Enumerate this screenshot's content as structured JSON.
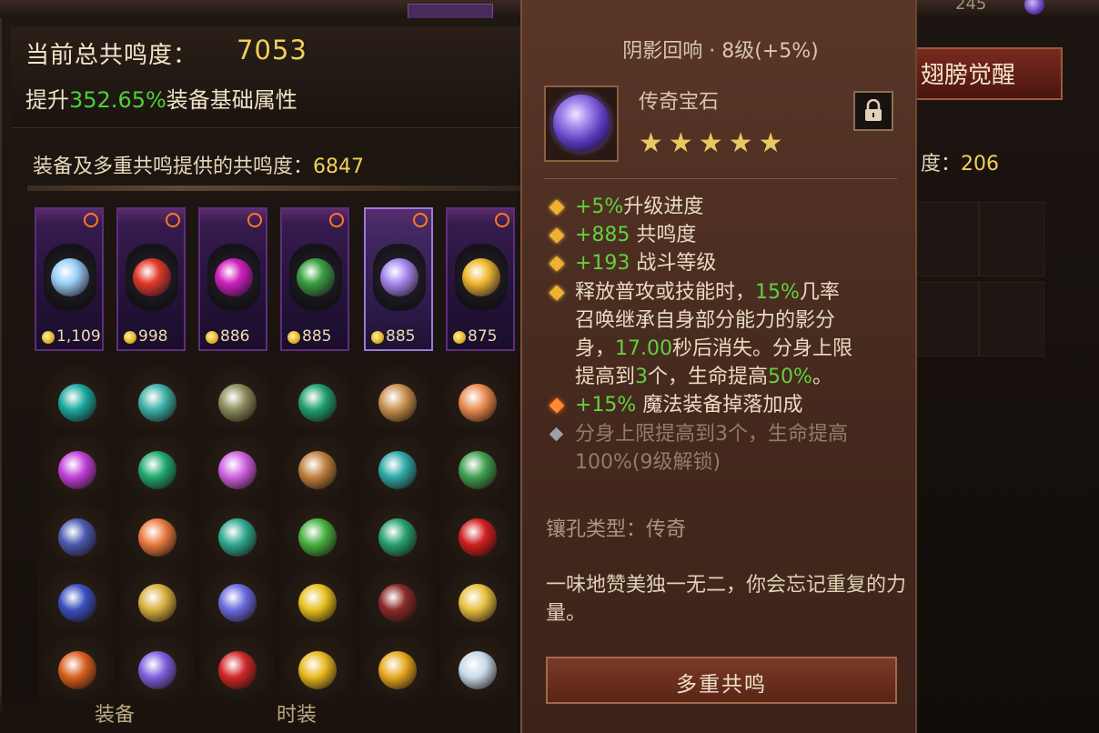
{
  "top": {
    "right_text": "245"
  },
  "header": {
    "total_label": "当前总共鸣度：",
    "total_value": "7053",
    "boost_prefix": "提升",
    "boost_value": "352.65%",
    "boost_suffix": "装备基础属性"
  },
  "resonance": {
    "label": "装备及多重共鸣提供的共鸣度：",
    "value": "6847"
  },
  "slots": [
    {
      "value": "1,109",
      "gem_color": "#9ad0f8"
    },
    {
      "value": "998",
      "gem_color": "#e23a2a"
    },
    {
      "value": "886",
      "gem_color": "#d020c0"
    },
    {
      "value": "885",
      "gem_color": "#3aa040"
    },
    {
      "value": "885",
      "gem_color": "#a88af0"
    },
    {
      "value": "875",
      "gem_color": "#f0b830"
    }
  ],
  "gem_grid": [
    [
      "#1aa8a0",
      "#3cb0a8",
      "#8a8a5a",
      "#20a070",
      "#c89050",
      "#e88a50"
    ],
    [
      "#c040d8",
      "#20a870",
      "#d060e0",
      "#c08040",
      "#30a8a8",
      "#40a050"
    ],
    [
      "#4a5ab0",
      "#e87a40",
      "#30a890",
      "#48b040",
      "#28a070",
      "#d02020"
    ],
    [
      "#3a50c0",
      "#d8b040",
      "#6a6ae0",
      "#e8c020",
      "#8a2a2a",
      "#e8c040"
    ],
    [
      "#d86020",
      "#8060e0",
      "#d02828",
      "#e8b820",
      "#e8a820",
      "#c8d8e8"
    ]
  ],
  "bottom_tabs": [
    "装备",
    "时装"
  ],
  "right": {
    "awaken_label": "翅膀觉醒",
    "res_label": "度：",
    "res_value": "206"
  },
  "tooltip": {
    "title": "阴影回响 · 8级(+5%)",
    "type": "传奇宝石",
    "stars": "★★★★★",
    "lines": [
      {
        "bullet": "gold",
        "segments": [
          {
            "t": "+5%",
            "g": true
          },
          {
            "t": "升级进度",
            "g": false
          }
        ]
      },
      {
        "bullet": "gold",
        "segments": [
          {
            "t": "+885 ",
            "g": true
          },
          {
            "t": "共鸣度",
            "g": false
          }
        ]
      },
      {
        "bullet": "gold",
        "segments": [
          {
            "t": "+193 ",
            "g": true
          },
          {
            "t": "战斗等级",
            "g": false
          }
        ]
      },
      {
        "bullet": "gold",
        "segments": [
          {
            "t": "释放普攻或技能时，",
            "g": false
          },
          {
            "t": "15%",
            "g": true
          },
          {
            "t": "几率",
            "g": false
          }
        ]
      },
      {
        "bullet": null,
        "segments": [
          {
            "t": "召唤继承自身部分能力的影分",
            "g": false
          }
        ]
      },
      {
        "bullet": null,
        "segments": [
          {
            "t": "身，",
            "g": false
          },
          {
            "t": "17.00",
            "g": true
          },
          {
            "t": "秒后消失。分身上限",
            "g": false
          }
        ]
      },
      {
        "bullet": null,
        "segments": [
          {
            "t": "提高到",
            "g": false
          },
          {
            "t": "3",
            "g": true
          },
          {
            "t": "个，生命提高",
            "g": false
          },
          {
            "t": "50%",
            "g": true
          },
          {
            "t": "。",
            "g": false
          }
        ]
      },
      {
        "bullet": "fire",
        "segments": [
          {
            "t": "+15% ",
            "g": true
          },
          {
            "t": "魔法装备掉落加成",
            "g": false
          }
        ]
      },
      {
        "bullet": "grey",
        "dim": true,
        "segments": [
          {
            "t": "分身上限提高到3个，生命提高",
            "g": false
          }
        ]
      },
      {
        "bullet": null,
        "dim": true,
        "segments": [
          {
            "t": "100%(9级解锁)",
            "g": false
          }
        ]
      }
    ],
    "socket": "镶孔类型：传奇",
    "flavor": "一味地赞美独一无二，你会忘记重复的力量。",
    "button": "多重共鸣"
  }
}
